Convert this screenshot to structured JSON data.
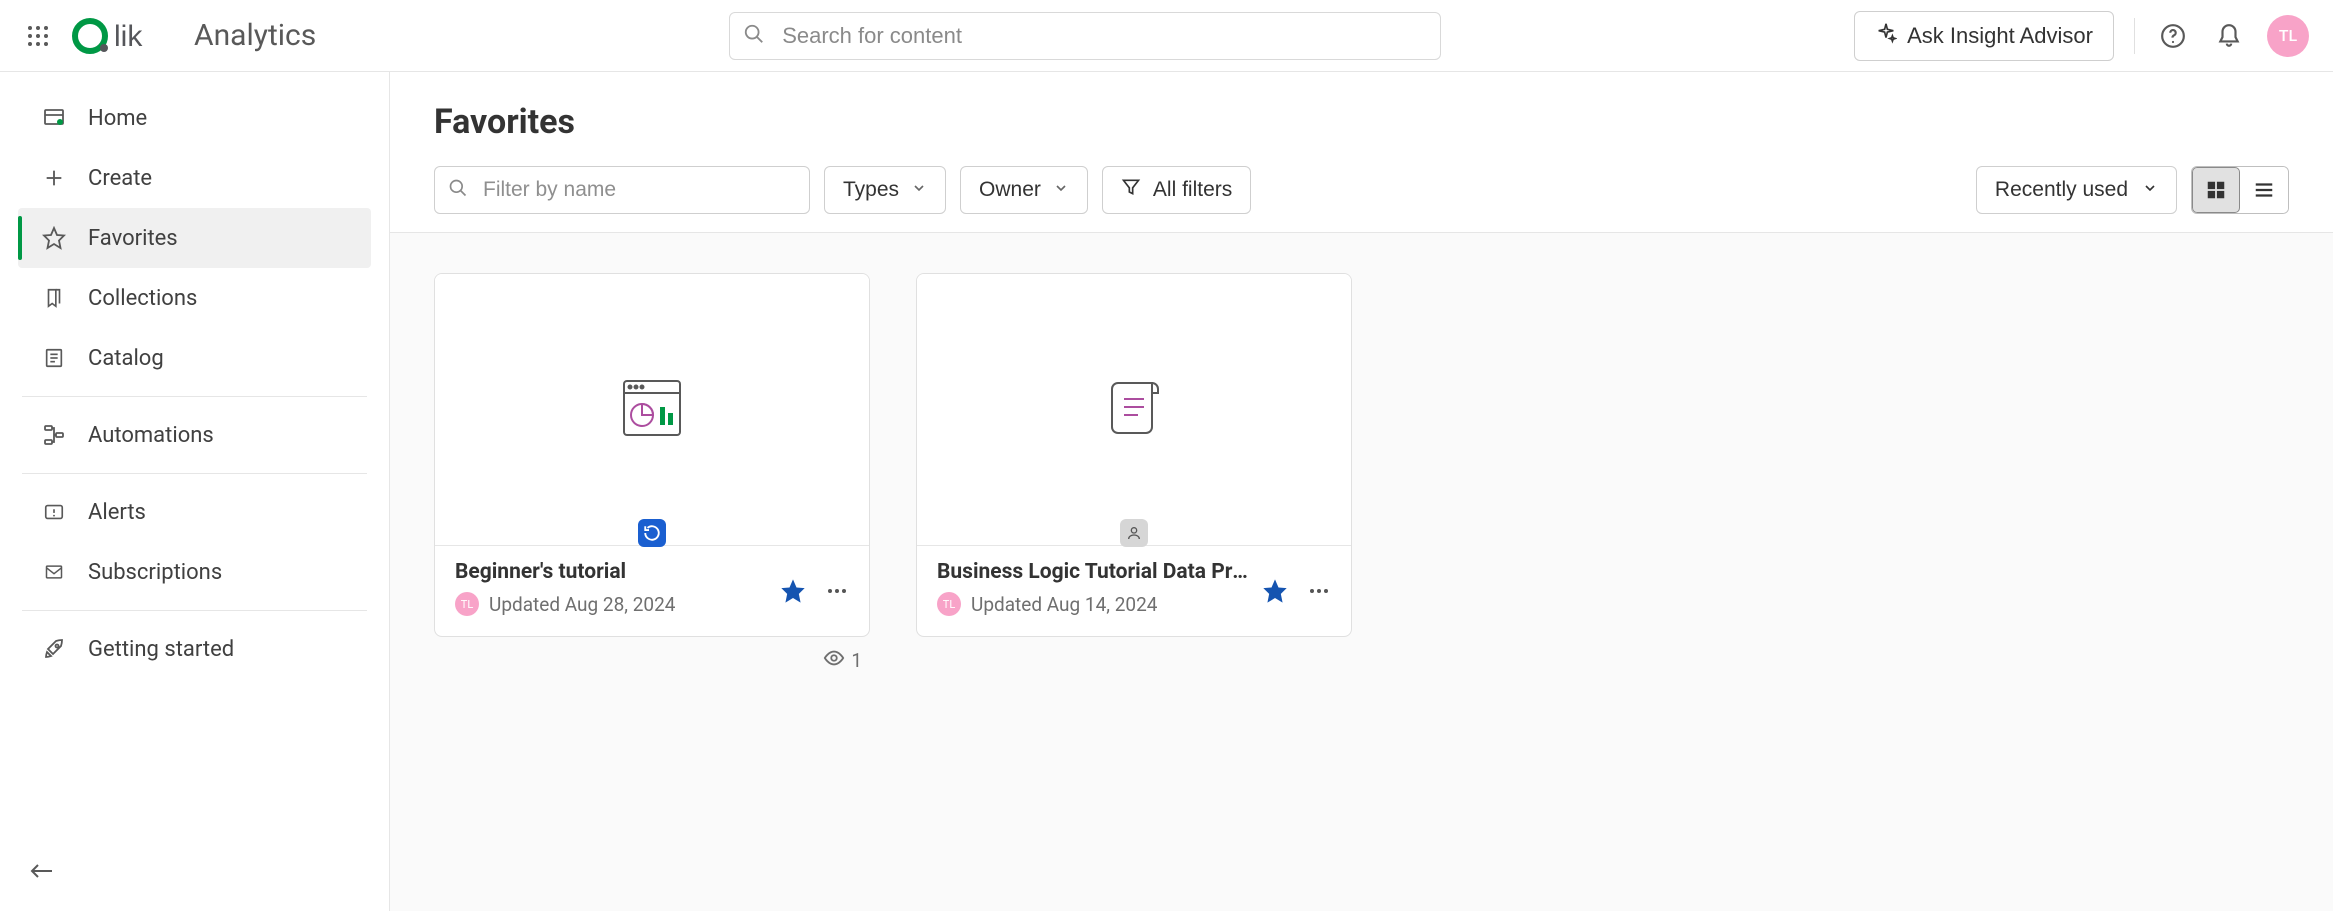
{
  "header": {
    "product": "Analytics",
    "search_placeholder": "Search for content",
    "insight_label": "Ask Insight Advisor",
    "avatar_initials": "TL"
  },
  "sidebar": {
    "items": [
      {
        "label": "Home"
      },
      {
        "label": "Create"
      },
      {
        "label": "Favorites"
      },
      {
        "label": "Collections"
      },
      {
        "label": "Catalog"
      },
      {
        "label": "Automations"
      },
      {
        "label": "Alerts"
      },
      {
        "label": "Subscriptions"
      },
      {
        "label": "Getting started"
      }
    ]
  },
  "page": {
    "title": "Favorites",
    "filter_placeholder": "Filter by name",
    "types_label": "Types",
    "owner_label": "Owner",
    "all_filters_label": "All filters",
    "sort_label": "Recently used"
  },
  "cards": [
    {
      "title": "Beginner's tutorial",
      "updated": "Updated Aug 28, 2024",
      "owner_initials": "TL",
      "views": "1"
    },
    {
      "title": "Business Logic Tutorial Data Prep",
      "updated": "Updated Aug 14, 2024",
      "owner_initials": "TL"
    }
  ]
}
